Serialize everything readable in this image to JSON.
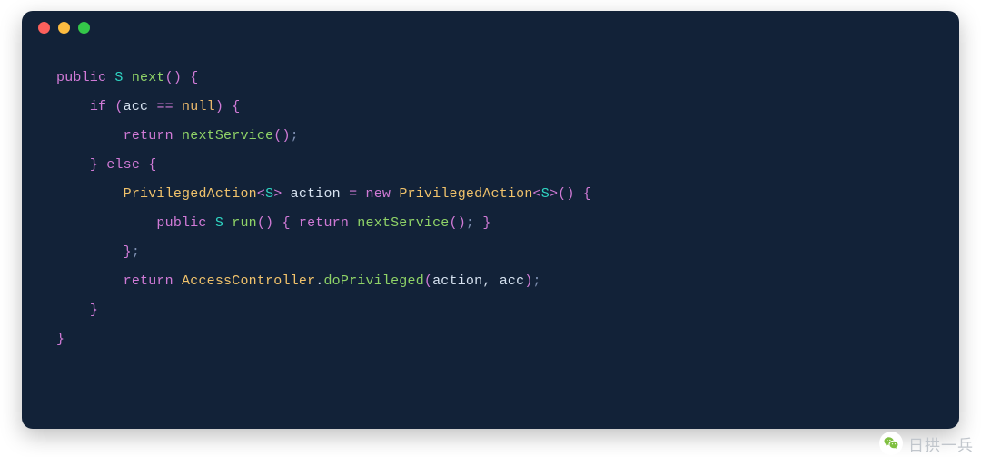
{
  "watermark": {
    "text": "日拱一兵"
  },
  "code": {
    "l1": {
      "kw_public": "public",
      "type_S": "S",
      "fn_next": "next",
      "parens": "()",
      "brace": " {"
    },
    "l2": {
      "kw_if": "if",
      "lp": "(",
      "var_acc": "acc",
      "op_eq": "==",
      "null": "null",
      "rp": ")",
      "brace": "{"
    },
    "l3": {
      "kw_return": "return",
      "fn_nextService": "nextService",
      "parens": "()",
      "semi": ";"
    },
    "l4": {
      "rbrace": "}",
      "kw_else": "else",
      "lbrace": "{"
    },
    "l5": {
      "cls": "PrivilegedAction",
      "lt": "<",
      "type_S": "S",
      "gt": ">",
      "var_action": "action",
      "op_assign": "=",
      "kw_new": "new",
      "cls2": "PrivilegedAction",
      "lt2": "<",
      "type_S2": "S",
      "gt2": ">",
      "parens": "()",
      "lbrace": "{"
    },
    "l6": {
      "kw_public": "public",
      "type_S": "S",
      "fn_run": "run",
      "parens": "()",
      "lbrace": "{",
      "kw_return": "return",
      "fn_nextService": "nextService",
      "parens2": "()",
      "semi": ";",
      "rbrace": "}"
    },
    "l7": {
      "rbrace": "}",
      "semi": ";"
    },
    "l8": {
      "kw_return": "return",
      "cls": "AccessController",
      "dot": ".",
      "fn": "doPrivileged",
      "lp": "(",
      "arg1": "action",
      "comma": ",",
      "arg2": "acc",
      "rp": ")",
      "semi": ";"
    },
    "l9": {
      "rbrace": "}"
    },
    "l10": {
      "rbrace": "}"
    }
  }
}
